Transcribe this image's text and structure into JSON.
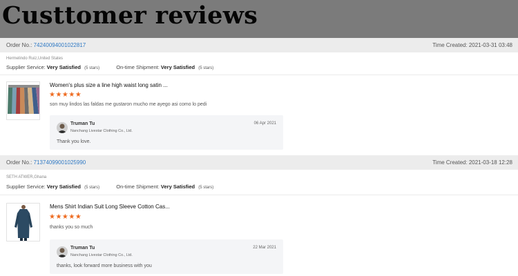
{
  "banner": {
    "title": "Custtomer reviews"
  },
  "labels": {
    "order_no": "Order No.:",
    "time_created": "Time Created:",
    "supplier_service": "Supplier Service:",
    "ontime_shipment": "On-time Shipment:"
  },
  "reviews": [
    {
      "order_number": "74240094001022817",
      "time_created": "2021-03-31 03:48",
      "buyer": "Hermelindo Ruiz,United States",
      "supplier_service": {
        "rating": "Very Satisfied",
        "stars_text": "(5 stars)"
      },
      "ontime_shipment": {
        "rating": "Very Satisfied",
        "stars_text": "(5 stars)"
      },
      "product_title": "Women's plus size a line high waist long satin ...",
      "stars": "★★★★★",
      "rating_value": 5,
      "review_text": "son muy lindos las faldas me gustaron mucho me ayego asi como lo pedi",
      "reply": {
        "seller": "Truman Tu",
        "company": "Nanchang Livestar Clothing Co., Ltd.",
        "date": "06 Apr 2021",
        "text": "Thank you love."
      }
    },
    {
      "order_number": "71374099001025990",
      "time_created": "2021-03-18 12:28",
      "buyer": "SETH ATWER,Ghana",
      "supplier_service": {
        "rating": "Very Satisfied",
        "stars_text": "(5 stars)"
      },
      "ontime_shipment": {
        "rating": "Very Satisfied",
        "stars_text": "(5 stars)"
      },
      "product_title": "Mens Shirt Indian Suit Long Sleeve Cotton Cas...",
      "stars": "★★★★★",
      "rating_value": 5,
      "review_text": "thanks you so much",
      "reply": {
        "seller": "Truman Tu",
        "company": "Nanchang Livestar Clothing Co., Ltd.",
        "date": "22 Mar 2021",
        "text": "thanks, look forward more business with you"
      }
    }
  ],
  "colors": {
    "banner": "#7b7b7b",
    "link": "#2f79c4",
    "star": "#ee6a1f",
    "order_bar": "#ececec",
    "reply_bg": "#f4f5f7"
  },
  "icons": {
    "product_1": "skirts-product-image",
    "product_2": "mens-suit-product-image",
    "avatar": "seller-avatar"
  }
}
